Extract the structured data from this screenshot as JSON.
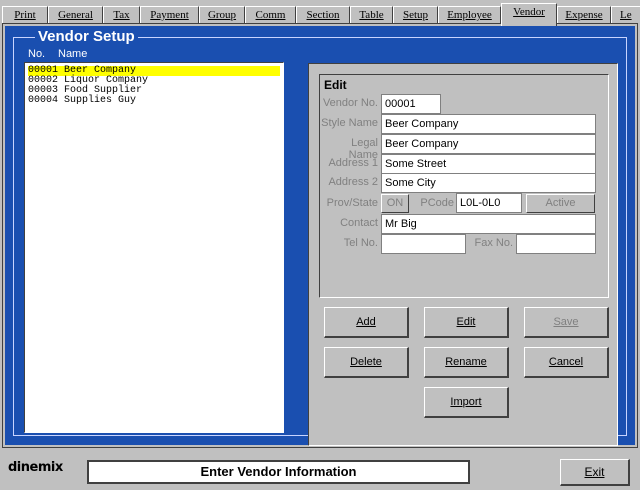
{
  "tabs": [
    {
      "label": "Print"
    },
    {
      "label": "General"
    },
    {
      "label": "Tax"
    },
    {
      "label": "Payment"
    },
    {
      "label": "Group"
    },
    {
      "label": "Comm"
    },
    {
      "label": "Section"
    },
    {
      "label": "Table"
    },
    {
      "label": "Setup"
    },
    {
      "label": "Employee"
    },
    {
      "label": "Vendor"
    },
    {
      "label": "Expense"
    },
    {
      "label": "Le"
    }
  ],
  "active_tab": "Vendor",
  "page_title": "Vendor Setup",
  "list": {
    "header_no": "No.",
    "header_name": "Name",
    "items": [
      {
        "text": "00001 Beer Company"
      },
      {
        "text": "00002 Liquor Company"
      },
      {
        "text": "00003 Food Supplier"
      },
      {
        "text": "00004 Supplies Guy"
      }
    ],
    "selected_index": 0
  },
  "edit": {
    "title": "Edit",
    "vendor_no_label": "Vendor No.",
    "vendor_no": "00001",
    "style_name_label": "Style Name",
    "style_name": "Beer Company",
    "legal_name_label": "Legal Name",
    "legal_name": "Beer Company",
    "address1_label": "Address 1",
    "address1": "Some Street",
    "address2_label": "Address 2",
    "address2": "Some City",
    "prov_label": "Prov/State",
    "prov": "ON",
    "pcode_label": "PCode",
    "pcode": "L0L-0L0",
    "status": "Active",
    "contact_label": "Contact",
    "contact": "Mr Big",
    "tel_label": "Tel No.",
    "tel": "",
    "fax_label": "Fax No.",
    "fax": ""
  },
  "buttons": {
    "add": "Add",
    "edit": "Edit",
    "save": "Save",
    "delete": "Delete",
    "rename": "Rename",
    "cancel": "Cancel",
    "import": "Import"
  },
  "footer": {
    "logo_text": "dinemix",
    "status": "Enter Vendor Information",
    "exit": "Exit"
  }
}
